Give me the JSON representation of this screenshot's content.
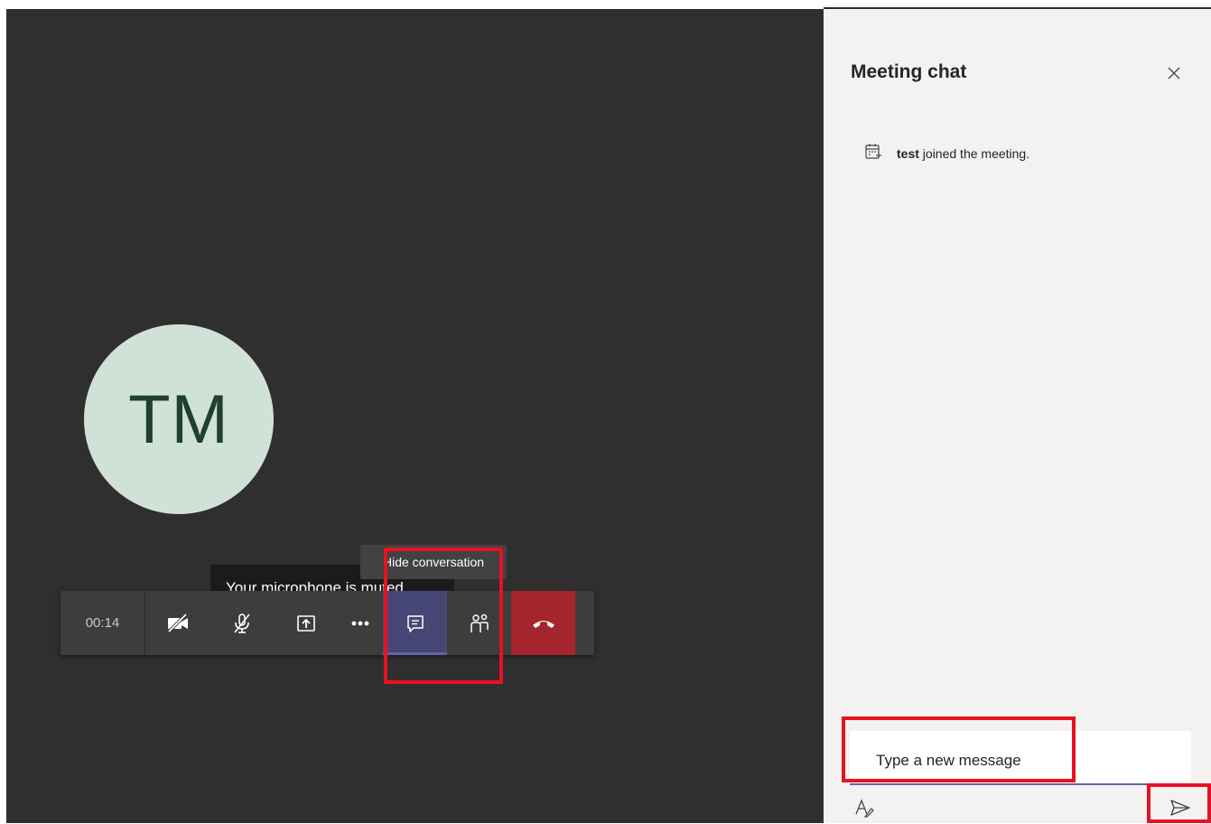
{
  "meeting": {
    "avatar_initials": "TM",
    "timer": "00:14",
    "mic_tooltip": "Your microphone is muted.",
    "chat_tooltip": "Hide conversation"
  },
  "controls": [
    {
      "name": "camera-off-button",
      "icon": "camera-off-icon"
    },
    {
      "name": "mic-muted-button",
      "icon": "mic-off-icon"
    },
    {
      "name": "share-screen-button",
      "icon": "share-tray-icon"
    },
    {
      "name": "more-actions-button",
      "icon": "more-dots-icon"
    },
    {
      "name": "chat-toggle-button",
      "icon": "chat-bubble-icon",
      "active": true
    },
    {
      "name": "participants-button",
      "icon": "people-icon"
    },
    {
      "name": "hang-up-button",
      "icon": "phone-hangup-icon"
    }
  ],
  "chat_panel": {
    "title": "Meeting chat",
    "messages": [
      {
        "user": "test",
        "text": "joined the meeting.",
        "icon": "calendar-add-icon"
      }
    ],
    "composer_placeholder": "Type a new message",
    "format_icon": "format-text-icon",
    "send_icon": "send-icon"
  },
  "colors": {
    "stage_bg": "#2f2f2f",
    "panel_bg": "#f3f2f1",
    "avatar_bg": "#d0e2d8",
    "avatar_text": "#1f4030",
    "hangup": "#a4262c",
    "active_chat": "#464775",
    "accent": "#6264a7",
    "highlight": "#e81123"
  }
}
